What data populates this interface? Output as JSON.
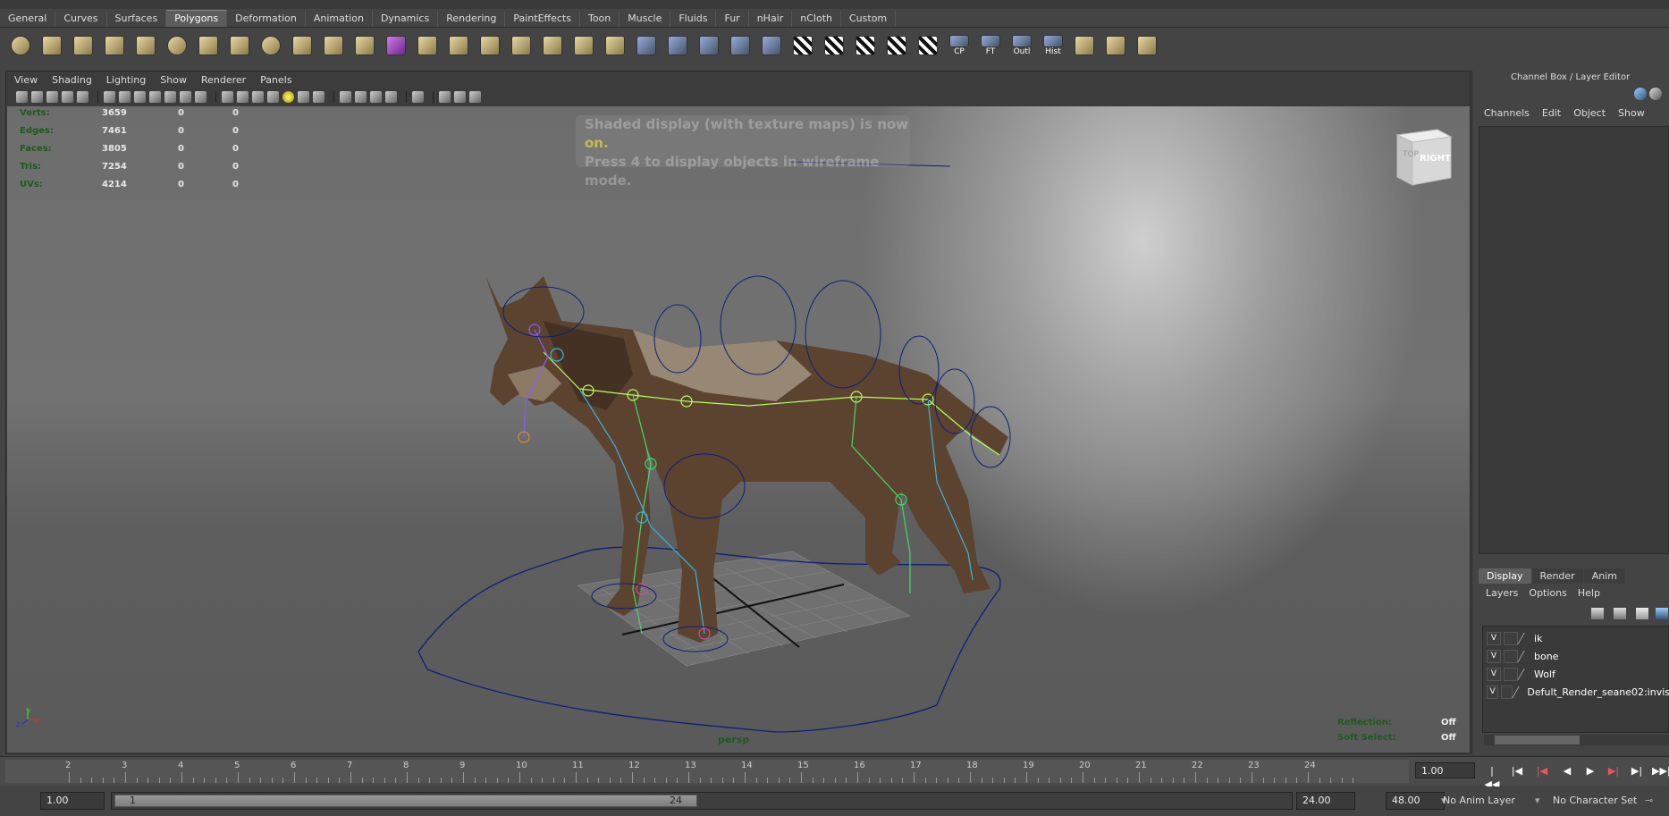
{
  "shelf_tabs": [
    "General",
    "Curves",
    "Surfaces",
    "Polygons",
    "Deformation",
    "Animation",
    "Dynamics",
    "Rendering",
    "PaintEffects",
    "Toon",
    "Muscle",
    "Fluids",
    "Fur",
    "nHair",
    "nCloth",
    "Custom"
  ],
  "shelf_active": "Polygons",
  "shelf_icons": [
    {
      "icon": "poly-sphere-icon"
    },
    {
      "icon": "poly-cube-icon"
    },
    {
      "icon": "poly-cylinder-icon"
    },
    {
      "icon": "poly-cone-icon"
    },
    {
      "icon": "poly-plane-icon"
    },
    {
      "icon": "poly-torus-icon"
    },
    {
      "icon": "poly-pyramid-icon"
    },
    {
      "icon": "poly-pipe-icon"
    },
    {
      "icon": "poly-helix-icon"
    },
    {
      "icon": "combine-icon"
    },
    {
      "icon": "separate-icon"
    },
    {
      "icon": "extract-icon"
    },
    {
      "icon": "smooth-purple-icon"
    },
    {
      "icon": "extrude-face-icon"
    },
    {
      "icon": "split-polygon-icon"
    },
    {
      "icon": "append-polygon-icon"
    },
    {
      "icon": "insert-edge-loop-icon"
    },
    {
      "icon": "bevel-icon"
    },
    {
      "icon": "bridge-icon"
    },
    {
      "icon": "merge-icon"
    },
    {
      "icon": "poke-icon"
    },
    {
      "icon": "wedge-icon"
    },
    {
      "icon": "duplicate-face-icon"
    },
    {
      "icon": "planar-map-icon"
    },
    {
      "icon": "uv-editor-icon"
    },
    {
      "icon": "checker-icon"
    },
    {
      "icon": "checker-2-icon"
    },
    {
      "icon": "checker-3-icon"
    },
    {
      "icon": "checker-4-icon"
    },
    {
      "icon": "checker-5-icon"
    }
  ],
  "shelf_text_icons": [
    {
      "icon": "center-pivot-icon",
      "label": "CP"
    },
    {
      "icon": "freeze-transform-icon",
      "label": "FT"
    },
    {
      "icon": "outliner-icon",
      "label": "Outl"
    },
    {
      "icon": "history-icon",
      "label": "Hist"
    }
  ],
  "viewport_menu": [
    "View",
    "Shading",
    "Lighting",
    "Show",
    "Renderer",
    "Panels"
  ],
  "hud": [
    {
      "label": "Verts:",
      "v1": "3659",
      "v2": "0",
      "v3": "0"
    },
    {
      "label": "Edges:",
      "v1": "7461",
      "v2": "0",
      "v3": "0"
    },
    {
      "label": "Faces:",
      "v1": "3805",
      "v2": "0",
      "v3": "0"
    },
    {
      "label": "Tris:",
      "v1": "7254",
      "v2": "0",
      "v3": "0"
    },
    {
      "label": "UVs:",
      "v1": "4214",
      "v2": "0",
      "v3": "0"
    }
  ],
  "message": {
    "line1_pre": "Shaded display (with texture maps) is now ",
    "line1_on": "on.",
    "line2": "Press 4 to display objects in wireframe mode."
  },
  "view_cube_label": "RIGHT",
  "camera_name": "persp",
  "reflection": {
    "label": "Reflection:",
    "value": "Off"
  },
  "soft_select": {
    "label": "Soft Select:",
    "value": "Off"
  },
  "axis": {
    "x": "x",
    "y": "y",
    "z": "z"
  },
  "right_panel": {
    "title": "Channel Box / Layer Editor",
    "menu": [
      "Channels",
      "Edit",
      "Object",
      "Show"
    ],
    "layer_tabs": [
      "Display",
      "Render",
      "Anim"
    ],
    "layer_tab_active": "Display",
    "layer_menu": [
      "Layers",
      "Options",
      "Help"
    ],
    "layers": [
      {
        "visible": "V",
        "name": "ik"
      },
      {
        "visible": "V",
        "name": "bone"
      },
      {
        "visible": "V",
        "name": "Wolf"
      },
      {
        "visible": "V",
        "name": "Defult_Render_seane02:invis"
      }
    ]
  },
  "timeline": {
    "ticks": [
      "2",
      "3",
      "4",
      "5",
      "6",
      "7",
      "8",
      "9",
      "10",
      "11",
      "12",
      "13",
      "14",
      "15",
      "16",
      "17",
      "18",
      "19",
      "20",
      "21",
      "22",
      "23",
      "24"
    ],
    "current": "1.00"
  },
  "range": {
    "start": "1.00",
    "inner_start": "1",
    "inner_end": "24",
    "end": "24.00",
    "max_end": "48.00",
    "anim_layer": "No Anim Layer",
    "character_set": "No Character Set"
  }
}
